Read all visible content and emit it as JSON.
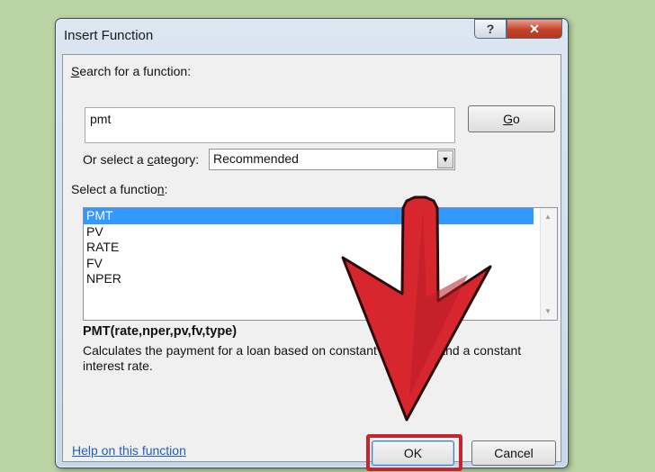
{
  "dialog": {
    "title": "Insert Function",
    "help_button": "?",
    "close_button": "✕"
  },
  "search": {
    "label_prefix": "",
    "label_hotkey": "S",
    "label_rest": "earch for a function:",
    "value": "pmt",
    "go_hotkey": "G",
    "go_rest": "o"
  },
  "category": {
    "label_prefix": "Or select a ",
    "label_hotkey": "c",
    "label_rest": "ategory:",
    "selected": "Recommended",
    "arrow": "▼"
  },
  "functions": {
    "label_prefix": "Select a functio",
    "label_hotkey": "n",
    "label_rest": ":",
    "items": [
      "PMT",
      "PV",
      "RATE",
      "FV",
      "NPER"
    ],
    "selected_index": 0
  },
  "details": {
    "syntax": "PMT(rate,nper,pv,fv,type)",
    "description": "Calculates the payment for a loan based on constant payments and a constant interest rate."
  },
  "footer": {
    "help_link": "Help on this function",
    "ok_label": "OK",
    "cancel_label": "Cancel"
  },
  "colors": {
    "background": "#b9d3a3",
    "selection": "#3399ff",
    "arrow_fill": "#d8262f",
    "highlight_border": "#c8242e"
  },
  "icons": [
    "help-icon",
    "close-icon",
    "dropdown-arrow-icon",
    "scroll-up-icon",
    "scroll-down-icon",
    "red-arrow-annotation"
  ]
}
